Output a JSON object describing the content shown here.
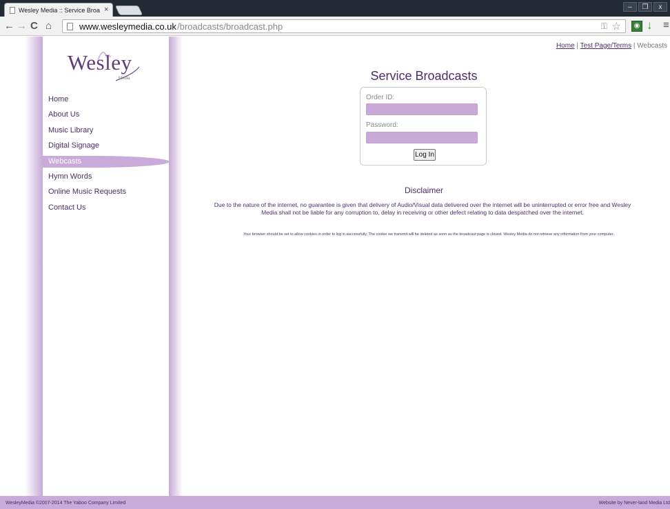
{
  "browser": {
    "tab_title": "Wesley Media :: Service Broa",
    "tab_close": "×",
    "url_host": "www.wesleymedia.co.uk",
    "url_path": "/broadcasts/broadcast.php",
    "window_buttons": [
      "–",
      "❐",
      "x"
    ]
  },
  "logo": {
    "text": "Wesley",
    "sub": "Media"
  },
  "sidebar": {
    "items": [
      {
        "label": "Home",
        "active": false
      },
      {
        "label": "About Us",
        "active": false
      },
      {
        "label": "Music Library",
        "active": false
      },
      {
        "label": "Digital Signage",
        "active": false
      },
      {
        "label": "Webcasts",
        "active": true
      },
      {
        "label": "Hymn Words",
        "active": false
      },
      {
        "label": "Online Music Requests",
        "active": false
      },
      {
        "label": "Contact Us",
        "active": false
      }
    ]
  },
  "breadcrumb": {
    "home": "Home",
    "sep1": " | ",
    "terms": "Test Page/Terms",
    "sep2": " | ",
    "current": "Webcasts"
  },
  "main": {
    "title": "Service Broadcasts",
    "login": {
      "order_label": "Order ID:",
      "order_value": "",
      "password_label": "Password:",
      "password_value": "",
      "button": "Log In"
    },
    "disclaimer_title": "Disclaimer",
    "disclaimer_text": "Due to the nature of the internet, no guarantee is given that delivery of Audio/Visual data delivered over the internet will be uninterrupted or error free and Wesley Media shall not be liable for any corruption to, delay in receiving or other defect relating to data despatched over the internet.",
    "cookie_note": "Your browser should be set to allow cookies in order to log in successfully. The cookie we transmit will be deleted as soon as the broadcast page is closed. Wesley Media do not retrieve any information from your computer."
  },
  "footer": {
    "left": "WesleyMedia ©2007-2014 The Yaboo Company Limited",
    "right": "Website by Never-land Media Ltd"
  },
  "colors": {
    "accent": "#4a2e6a",
    "lilac": "#c9aad9"
  }
}
